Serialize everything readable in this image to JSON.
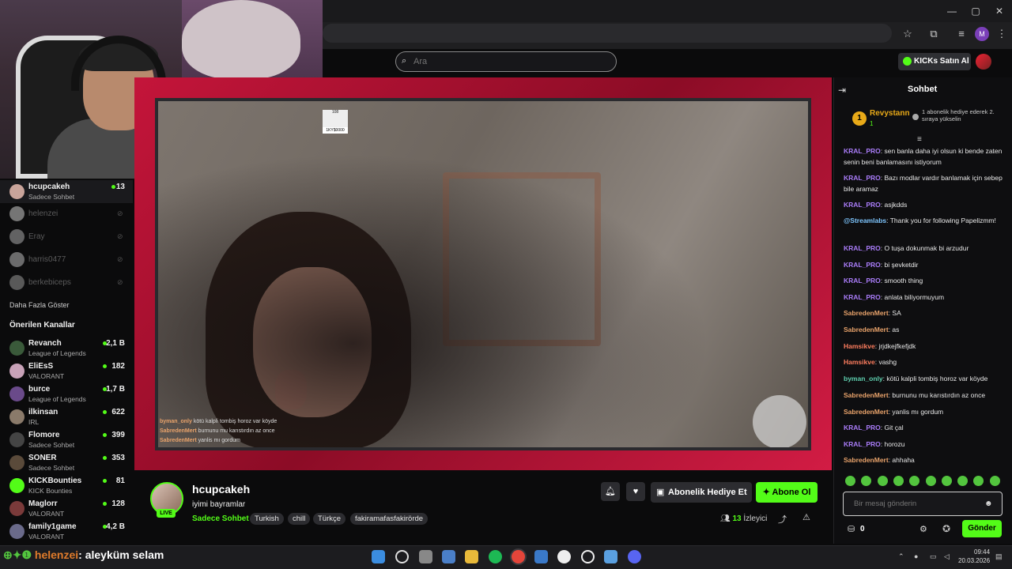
{
  "search": {
    "placeholder": "Ara"
  },
  "header": {
    "kicks_label": "KICKs Satın Al"
  },
  "sidebar": {
    "followed": [
      {
        "name": "hcupcakeh",
        "sub": "Sadece Sohbet",
        "count": "13",
        "live": true
      },
      {
        "name": "helenzei",
        "live": false
      },
      {
        "name": "Eray",
        "live": false
      },
      {
        "name": "harris0477",
        "live": false
      },
      {
        "name": "berkebiceps",
        "live": false
      }
    ],
    "more_label": "Daha Fazla Göster",
    "recommended_title": "Önerilen Kanallar",
    "recommended": [
      {
        "name": "Revanch",
        "sub": "League of Legends",
        "count": "2,1 B"
      },
      {
        "name": "EliEsS",
        "sub": "VALORANT",
        "count": "182"
      },
      {
        "name": "burce",
        "sub": "League of Legends",
        "count": "1,7 B"
      },
      {
        "name": "ilkinsan",
        "sub": "IRL",
        "count": "622"
      },
      {
        "name": "Flomore",
        "sub": "Sadece Sohbet",
        "count": "399"
      },
      {
        "name": "SONER",
        "sub": "Sadece Sohbet",
        "count": "353"
      },
      {
        "name": "KICKBounties",
        "sub": "KICK Bounties",
        "count": "81"
      },
      {
        "name": "Maglorr",
        "sub": "VALORANT",
        "count": "128"
      },
      {
        "name": "family1game",
        "sub": "VALORANT",
        "count": "4,2 B"
      }
    ]
  },
  "video_overlay": {
    "chat": [
      {
        "user": "byman_only",
        "text": "kötü kalpli tombiş horoz var köyde"
      },
      {
        "user": "SabredenMert",
        "text": "burnunu mu karıstırdın az once"
      },
      {
        "user": "SabredenMert",
        "text": "yanlis mı gordum"
      }
    ],
    "box_a": "108",
    "box_b": "1KY$0000"
  },
  "stream": {
    "name": "hcupcakeh",
    "title": "iyimi bayramlar",
    "live": "LIVE",
    "category": "Sadece Sohbet",
    "tags": [
      "Turkish",
      "chill",
      "Türkçe",
      "fakiramafasfakirörde"
    ],
    "gift_label": "Abonelik Hediye Et",
    "subscribe_label": "Abone Ol",
    "viewers": "13",
    "viewers_label": "İzleyici"
  },
  "chat": {
    "title": "Sohbet",
    "pinned": {
      "rank": "1",
      "name": "Revystann",
      "sub": "1",
      "text": "1 abonelik hediye ederek 2. sıraya yükselin"
    },
    "messages": [
      {
        "user": "KRAL_PRO",
        "cls": "u-kral",
        "text": "sen banla daha iyi olsun ki bende zaten senin beni banlamasını istiyorum"
      },
      {
        "user": "KRAL_PRO",
        "cls": "u-kral",
        "text": "Bazı modlar vardır banlamak için sebep bile aramaz"
      },
      {
        "user": "KRAL_PRO",
        "cls": "u-kral",
        "text": "asjkdds"
      },
      {
        "user": "@Streamlabs",
        "cls": "u-sl",
        "text": "Thank you for following Papelizmm!"
      },
      {
        "user": "KRAL_PRO",
        "cls": "u-kral",
        "text": "O tuşa dokunmak bi arzudur"
      },
      {
        "user": "KRAL_PRO",
        "cls": "u-kral",
        "text": "bi şevketdir"
      },
      {
        "user": "KRAL_PRO",
        "cls": "u-kral",
        "text": "smooth thing"
      },
      {
        "user": "KRAL_PRO",
        "cls": "u-kral",
        "text": "anlata biliyormuyum"
      },
      {
        "user": "SabredenMert",
        "cls": "u-sab",
        "text": "SA"
      },
      {
        "user": "SabredenMert",
        "cls": "u-sab",
        "text": "as"
      },
      {
        "user": "Hamsikve",
        "cls": "u-ham",
        "text": "jrjdkejfkefjdk"
      },
      {
        "user": "Hamsikve",
        "cls": "u-ham",
        "text": "vashg"
      },
      {
        "user": "byman_only",
        "cls": "u-by",
        "text": "kötü kalpli tombiş horoz var köyde"
      },
      {
        "user": "SabredenMert",
        "cls": "u-sab",
        "text": "burnunu mu karıstırdın az once"
      },
      {
        "user": "SabredenMert",
        "cls": "u-sab",
        "text": "yanlis mı gordum"
      },
      {
        "user": "KRAL_PRO",
        "cls": "u-kral",
        "text": "Git çal"
      },
      {
        "user": "KRAL_PRO",
        "cls": "u-kral",
        "text": "horozu"
      },
      {
        "user": "SabredenMert",
        "cls": "u-sab",
        "text": "ahhaha"
      }
    ],
    "input_placeholder": "Bir mesaj gönderin",
    "points": "0",
    "send_label": "Gönder"
  },
  "taskbar": {
    "alert_user": "helenzei",
    "alert_text": ": aleyküm selam",
    "time": "09:44",
    "date": "20.03.2026"
  },
  "colors": {
    "kick_green": "#53fc18",
    "frame_red": "#c4153a"
  }
}
